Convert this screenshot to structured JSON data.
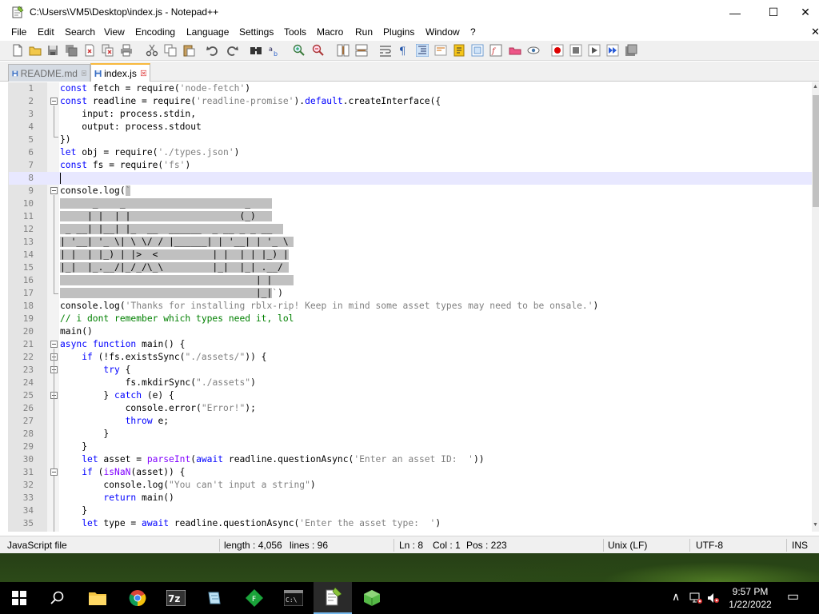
{
  "window": {
    "title": "C:\\Users\\VM5\\Desktop\\index.js - Notepad++",
    "minimize_glyph": "—",
    "maximize_glyph": "☐",
    "close_glyph": "✕"
  },
  "menu": {
    "items": [
      "File",
      "Edit",
      "Search",
      "View",
      "Encoding",
      "Language",
      "Settings",
      "Tools",
      "Macro",
      "Run",
      "Plugins",
      "Window",
      "?"
    ],
    "close_doc_glyph": "✕"
  },
  "toolbar": {
    "icons": [
      "new-file-icon",
      "open-file-icon",
      "save-icon",
      "save-all-icon",
      "close-icon",
      "close-all-icon",
      "print-icon",
      "cut-icon",
      "copy-icon",
      "paste-icon",
      "undo-icon",
      "redo-icon",
      "find-icon",
      "replace-icon",
      "zoom-in-icon",
      "zoom-out-icon",
      "sync-vertical-icon",
      "sync-horizontal-icon",
      "word-wrap-icon",
      "show-all-chars-icon",
      "indent-guide-icon",
      "udl-icon",
      "doc-map-icon",
      "function-list-icon",
      "folder-workspace-icon",
      "monitoring-icon",
      "record-macro-icon",
      "stop-macro-icon",
      "play-macro-icon",
      "run-macro-multiple-icon",
      "save-macro-icon"
    ]
  },
  "tabs": [
    {
      "label": "README.md",
      "active": false
    },
    {
      "label": "index.js",
      "active": true
    }
  ],
  "editor": {
    "current_line": 8,
    "lines": [
      {
        "n": "1",
        "html": "<span class=\"kw\">const</span> fetch = require(<span class=\"str\">'node-fetch'</span>)"
      },
      {
        "n": "2",
        "html": "<span class=\"kw\">const</span> readline = require(<span class=\"str\">'readline-promise'</span>).<span class=\"kw\">default</span>.createInterface({"
      },
      {
        "n": "3",
        "html": "    input: process.stdin,"
      },
      {
        "n": "4",
        "html": "    output: process.stdout"
      },
      {
        "n": "5",
        "html": "})"
      },
      {
        "n": "6",
        "html": "<span class=\"kw\">let</span> obj = require(<span class=\"str\">'./types.json'</span>)"
      },
      {
        "n": "7",
        "html": "<span class=\"kw\">const</span> fs = require(<span class=\"str\">'fs'</span>)"
      },
      {
        "n": "8",
        "html": ""
      },
      {
        "n": "9",
        "html": "console.log(<span class=\"str sel\">`</span>"
      },
      {
        "n": "10",
        "html": "<span class=\"sel\">      _    _                      _    </span>"
      },
      {
        "n": "11",
        "html": "<span class=\"sel\">     | |  | |                    (_)   </span>"
      },
      {
        "n": "12",
        "html": "<span class=\"sel\"> _ __| |__| |_  __  ______  _ __ _ _ __  </span>"
      },
      {
        "n": "13",
        "html": "<span class=\"sel\">| '__| '_ \\| \\ \\/ / |______| | '__| | '_ \\ </span>"
      },
      {
        "n": "14",
        "html": "<span class=\"sel\">| |  | |_) | |>  <          | |  | | |_) |</span>"
      },
      {
        "n": "15",
        "html": "<span class=\"sel\">|_|  |_.__/|_/_/\\_\\         |_|  |_| .__/ </span>"
      },
      {
        "n": "16",
        "html": "<span class=\"sel\">                                    | |    </span>"
      },
      {
        "n": "17",
        "html": "<span class=\"sel\">                                    |_|</span><span class=\"str\">`</span>)"
      },
      {
        "n": "18",
        "html": "console.log(<span class=\"str\">'Thanks for installing rblx-rip! Keep in mind some asset types may need to be onsale.'</span>)"
      },
      {
        "n": "19",
        "html": "<span class=\"cmt\">// i dont remember which types need it, lol</span>"
      },
      {
        "n": "20",
        "html": "main()"
      },
      {
        "n": "21",
        "html": "<span class=\"kw\">async</span> <span class=\"kw\">function</span> main() {"
      },
      {
        "n": "22",
        "html": "    <span class=\"kw\">if</span> (!fs.existsSync(<span class=\"str\">\"./assets/\"</span>)) {"
      },
      {
        "n": "23",
        "html": "        <span class=\"kw\">try</span> {"
      },
      {
        "n": "24",
        "html": "            fs.mkdirSync(<span class=\"str\">\"./assets\"</span>)"
      },
      {
        "n": "25",
        "html": "        } <span class=\"kw\">catch</span> (e) {"
      },
      {
        "n": "26",
        "html": "            console.error(<span class=\"str\">\"Error!\"</span>);"
      },
      {
        "n": "27",
        "html": "            <span class=\"kw\">throw</span> e;"
      },
      {
        "n": "28",
        "html": "        }"
      },
      {
        "n": "29",
        "html": "    }"
      },
      {
        "n": "30",
        "html": "    <span class=\"kw\">let</span> asset = <span class=\"fn\">parseInt</span>(<span class=\"kw\">await</span> readline.questionAsync(<span class=\"str\">'Enter an asset ID:  '</span>))"
      },
      {
        "n": "31",
        "html": "    <span class=\"kw\">if</span> (<span class=\"fn\">isNaN</span>(asset)) {"
      },
      {
        "n": "32",
        "html": "        console.log(<span class=\"str\">\"You can't input a string\"</span>)"
      },
      {
        "n": "33",
        "html": "        <span class=\"kw\">return</span> main()"
      },
      {
        "n": "34",
        "html": "    }"
      },
      {
        "n": "35",
        "html": "    <span class=\"kw\">let</span> type = <span class=\"kw\">await</span> readline.questionAsync(<span class=\"str\">'Enter the asset type:  '</span>)"
      }
    ]
  },
  "status": {
    "file_type": "JavaScript file",
    "length": "length : 4,056",
    "lines": "lines : 96",
    "ln": "Ln : 8",
    "col": "Col : 1",
    "pos": "Pos : 223",
    "eol": "Unix (LF)",
    "encoding": "UTF-8",
    "mode": "INS"
  },
  "taskbar": {
    "apps": [
      "windows-start-icon",
      "search-icon",
      "file-explorer-icon",
      "chrome-icon",
      "7zip-icon",
      "notepad-icon",
      "green-app-icon",
      "cmd-icon",
      "notepadpp-icon",
      "green-cube-icon"
    ],
    "time": "9:57 PM",
    "date": "1/22/2022",
    "tray_up_glyph": "∧",
    "notification_glyph": "▭"
  }
}
